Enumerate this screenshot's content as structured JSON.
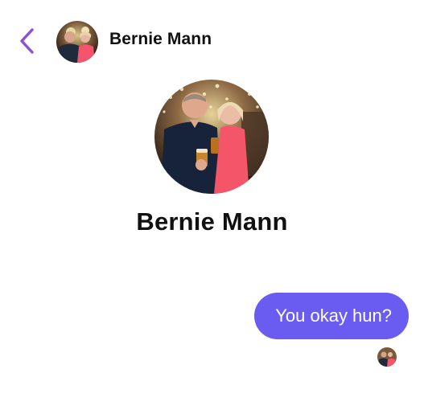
{
  "header": {
    "contact_name": "Bernie Mann",
    "back_icon": "chevron-left-icon",
    "accent_color": "#8b4fd8"
  },
  "profile": {
    "name": "Bernie Mann"
  },
  "conversation": {
    "messages": [
      {
        "direction": "outgoing",
        "text": "You okay hun?"
      }
    ],
    "bubble_color": "#6a5cf0",
    "read_receipt_icon": "contact-avatar-mini"
  }
}
